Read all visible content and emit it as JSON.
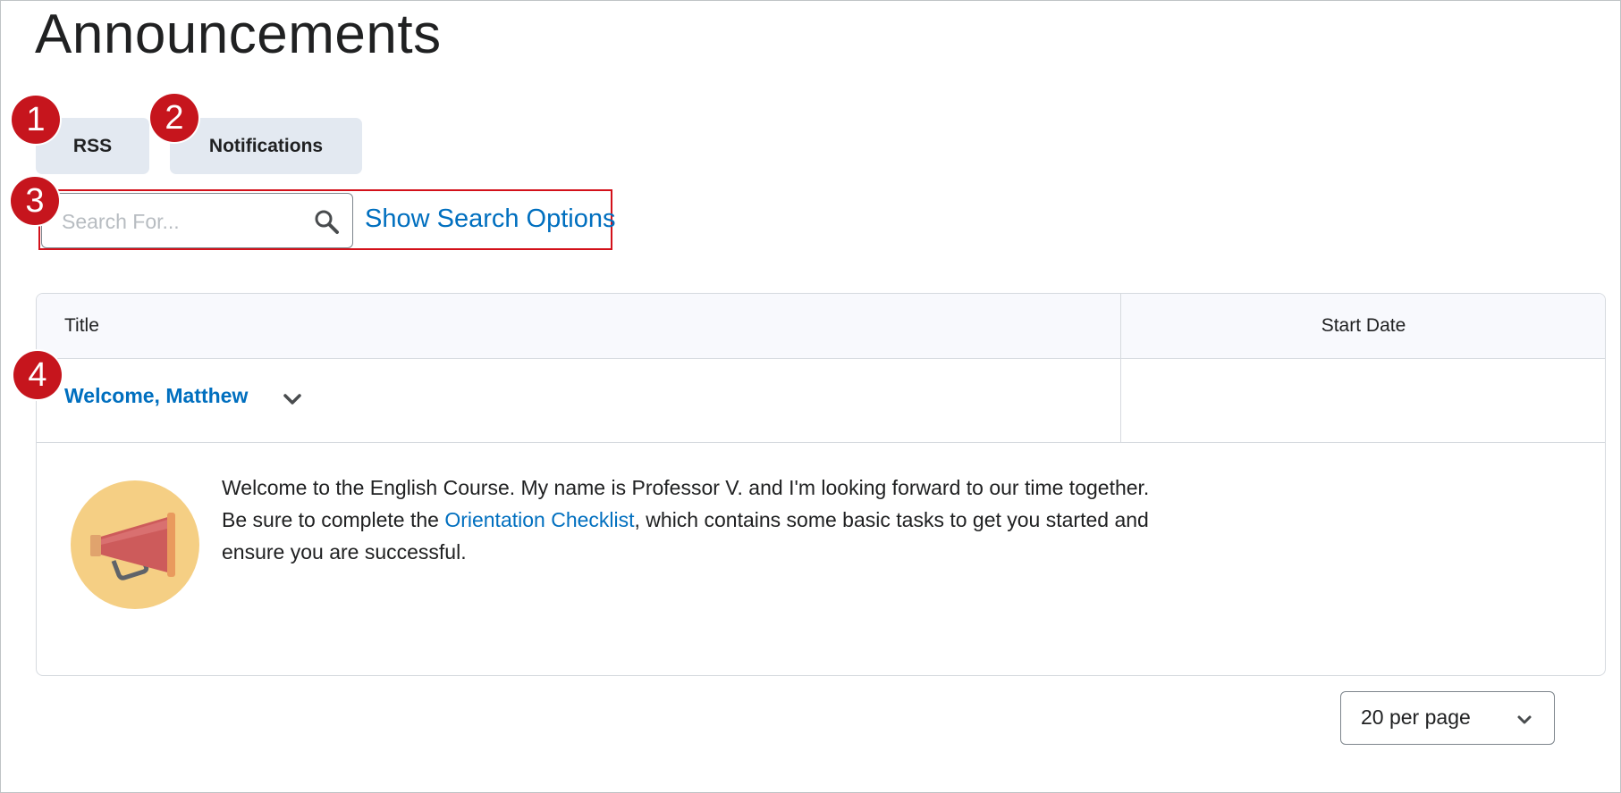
{
  "page": {
    "title": "Announcements"
  },
  "toolbar": {
    "rss_label": "RSS",
    "notifications_label": "Notifications"
  },
  "callouts": [
    "1",
    "2",
    "3",
    "4"
  ],
  "search": {
    "placeholder": "Search For...",
    "value": "",
    "options_link": "Show Search Options"
  },
  "table": {
    "columns": [
      "Title",
      "Start Date"
    ],
    "rows": [
      {
        "title": "Welcome, Matthew",
        "start_date": "",
        "body_before_link": "Welcome to the English Course. My name is Professor V. and I'm looking forward to our time together. Be sure to complete the ",
        "body_link": "Orientation Checklist",
        "body_after_link": ", which contains some basic tasks to get you started and ensure you are successful.",
        "image_icon": "megaphone-icon"
      }
    ]
  },
  "pagination": {
    "page_size_label": "20 per page"
  },
  "colors": {
    "link": "#006fbf",
    "badge": "#c6151d",
    "button_bg": "#e3e9f1",
    "highlight_border": "#d3111a"
  }
}
